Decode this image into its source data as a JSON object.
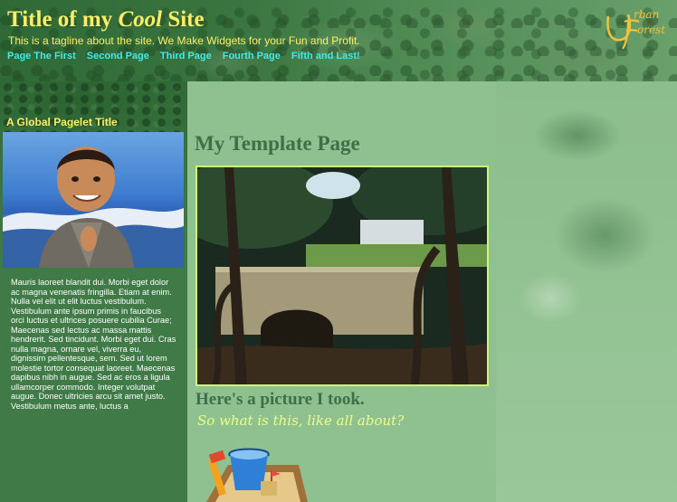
{
  "header": {
    "title_prefix": "Title of my ",
    "title_emphasis": "Cool",
    "title_suffix": " Site",
    "tagline": "This is a tagline about the site. We Make Widgets for your Fun and Profit.",
    "logo_text": "Urban Forest"
  },
  "nav": {
    "items": [
      {
        "label": "Page The First"
      },
      {
        "label": "Second Page"
      },
      {
        "label": "Third Page"
      },
      {
        "label": "Fourth Page"
      },
      {
        "label": "Fifth and Last!"
      }
    ]
  },
  "sidebar": {
    "pagelet_title": "A Global Pagelet Title",
    "pagelet_text": "Mauris laoreet blandit dui. Morbi eget dolor ac magna venenatis fringilla. Etiam at enim. Nulla vel elit ut elit luctus vestibulum. Vestibulum ante ipsum primis in faucibus orci luctus et ultrices posuere cubilia Curae; Maecenas sed lectus ac massa mattis hendrerit. Sed tincidunt. Morbi eget dui. Cras nulla magna, ornare vel, viverra eu, dignissim pellentesque, sem. Sed ut lorem molestie tortor consequat laoreet. Maecenas dapibus nibh in augue. Sed ac eros a ligula ullamcorper commodo. Integer volutpat augue. Donec ultricies arcu sit amet justo. Vestibulum metus ante, luctus a"
  },
  "main": {
    "page_title": "My Template Page",
    "caption": "Here's a picture I took.",
    "subcaption": "So what is this, like all about?"
  },
  "colors": {
    "title_yellow": "#ffee66",
    "nav_cyan": "#44eaea",
    "heading_green": "#3f6e48",
    "photo_border": "#ccf57a",
    "subcaption_yellow": "#eeff88"
  }
}
